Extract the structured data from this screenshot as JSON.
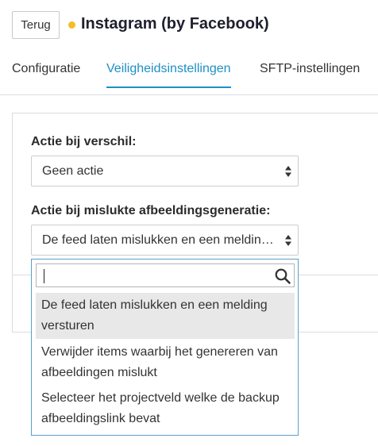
{
  "header": {
    "back_label": "Terug",
    "title": "Instagram (by Facebook)",
    "status_color": "#f5bd24"
  },
  "tabs": [
    {
      "label": "Configuratie",
      "active": false
    },
    {
      "label": "Veiligheidsinstellingen",
      "active": true
    },
    {
      "label": "SFTP-instellingen",
      "active": false
    }
  ],
  "form": {
    "diff_action": {
      "label": "Actie bij verschil:",
      "value": "Geen actie"
    },
    "image_fail_action": {
      "label": "Actie bij mislukte afbeeldingsgeneratie:",
      "value": "De feed laten mislukken en een meldin…"
    }
  },
  "dropdown": {
    "search_value": "",
    "options": [
      {
        "label": "De feed laten mislukken en een melding versturen",
        "highlighted": true
      },
      {
        "label": "Verwijder items waarbij het genereren van afbeeldingen mislukt",
        "highlighted": false
      },
      {
        "label": "Selecteer het projectveld welke de backup afbeeldingslink bevat",
        "highlighted": false
      }
    ]
  },
  "colors": {
    "accent": "#1f8fc4",
    "dropdown_border": "#5b9ec9",
    "highlight": "#e8e8e8"
  },
  "icons": {
    "search": "search-icon",
    "select_arrows": "updown-arrows-icon"
  }
}
